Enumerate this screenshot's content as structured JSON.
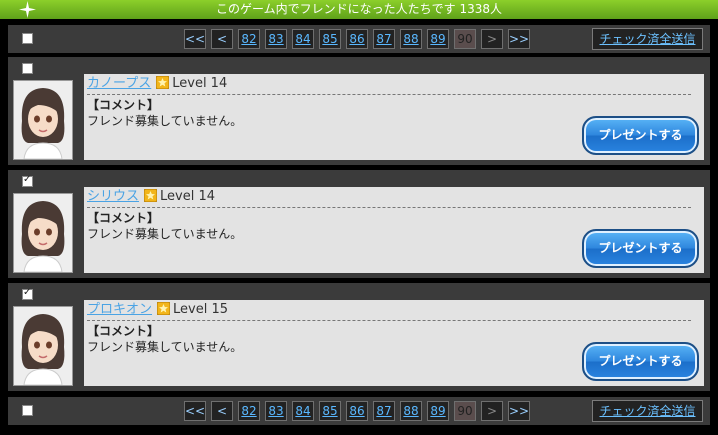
{
  "header": {
    "title": "このゲーム内でフレンドになった人たちです 1338人",
    "icon": "sparkle-icon"
  },
  "pager": {
    "first": "<<",
    "prev": "<",
    "pages": [
      "82",
      "83",
      "84",
      "85",
      "86",
      "87",
      "88",
      "89",
      "90"
    ],
    "current": "90",
    "next": ">",
    "last": ">>"
  },
  "bulk_action_label": "チェック済全送信",
  "friends": [
    {
      "name": "カノープス",
      "level": "Level 14",
      "comment_label": "【コメント】",
      "comment": "フレンド募集していません。",
      "present_label": "プレゼントする",
      "checked": false
    },
    {
      "name": "シリウス",
      "level": "Level 14",
      "comment_label": "【コメント】",
      "comment": "フレンド募集していません。",
      "present_label": "プレゼントする",
      "checked": true
    },
    {
      "name": "プロキオン",
      "level": "Level 15",
      "comment_label": "【コメント】",
      "comment": "フレンド募集していません。",
      "present_label": "プレゼントする",
      "checked": true
    }
  ],
  "colors": {
    "header": "#7fc31f",
    "bar": "#3b3b3b",
    "link": "#4aa3e4",
    "button": "#2f87de"
  }
}
